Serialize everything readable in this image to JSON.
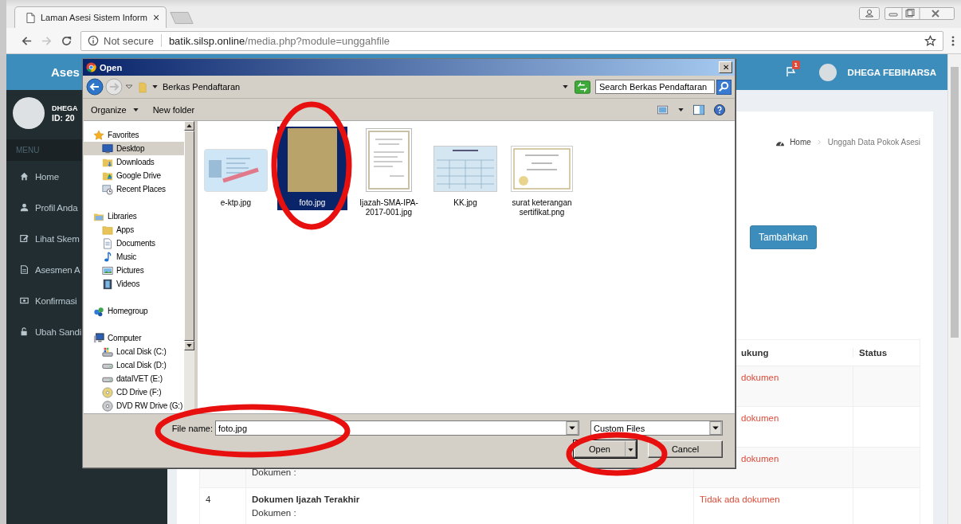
{
  "browser": {
    "tab_title": "Laman Asesi Sistem Inform",
    "close_glyph": "×",
    "security": "Not secure",
    "url_host": "batik.silsp.online",
    "url_path": "/media.php?module=unggahfile"
  },
  "app": {
    "header_title": "Ases",
    "notification_count": "1",
    "user_name": "DHEGA FEBIHARSA"
  },
  "sidebar": {
    "user_name": "DHEGA",
    "user_id": "ID: 20",
    "menu_heading": "MENU",
    "items": [
      {
        "label": "Home",
        "kind": "home"
      },
      {
        "label": "Profil Anda",
        "kind": "user"
      },
      {
        "label": "Lihat Skem",
        "kind": "edit"
      },
      {
        "label": "Asesmen A",
        "kind": "file"
      },
      {
        "label": "Konfirmasi",
        "kind": "money"
      },
      {
        "label": "Ubah Sandi",
        "kind": "unlock"
      }
    ]
  },
  "content": {
    "breadcrumb_home": "Home",
    "breadcrumb_current": "Unggah Data Pokok Asesi",
    "add_button": "Tambahkan",
    "table": {
      "columns": [
        {
          "label": "ukung",
          "covered": true
        },
        {
          "label": "Status",
          "covered": false
        }
      ],
      "rows": [
        {
          "support": "dokumen",
          "covered": true
        },
        {
          "support": "dokumen",
          "covered": true
        },
        {
          "doc_label": "Dokumen :",
          "support": "dokumen",
          "covered": true
        },
        {
          "number": "4",
          "title": "Dokumen Ijazah Terakhir",
          "doc_label": "Dokumen :",
          "support": "Tidak ada dokumen",
          "covered": false
        }
      ]
    }
  },
  "dialog": {
    "title": "Open",
    "close_glyph": "✕",
    "location": "Berkas Pendaftaran",
    "search_placeholder": "Search Berkas Pendaftaran",
    "toolbar": {
      "organize": "Organize",
      "new_folder": "New folder"
    },
    "nav": [
      {
        "label": "Favorites",
        "kind": "star",
        "selected": false,
        "children": [
          {
            "label": "Desktop",
            "kind": "desktop",
            "selected": true
          },
          {
            "label": "Downloads",
            "kind": "downloads",
            "selected": false
          },
          {
            "label": "Google Drive",
            "kind": "drive",
            "selected": false
          },
          {
            "label": "Recent Places",
            "kind": "recent",
            "selected": false
          }
        ]
      },
      {
        "label": "Libraries",
        "kind": "library",
        "selected": false,
        "children": [
          {
            "label": "Apps",
            "kind": "folder",
            "selected": false
          },
          {
            "label": "Documents",
            "kind": "documents",
            "selected": false
          },
          {
            "label": "Music",
            "kind": "music",
            "selected": false
          },
          {
            "label": "Pictures",
            "kind": "pictures",
            "selected": false
          },
          {
            "label": "Videos",
            "kind": "videos",
            "selected": false
          }
        ]
      },
      {
        "label": "Homegroup",
        "kind": "homegroup",
        "selected": false
      },
      {
        "label": "Computer",
        "kind": "computer",
        "selected": false,
        "children": [
          {
            "label": "Local Disk (C:)",
            "kind": "system-disk",
            "selected": false
          },
          {
            "label": "Local Disk (D:)",
            "kind": "disk",
            "selected": false
          },
          {
            "label": "dataIVET (E:)",
            "kind": "disk",
            "selected": false
          },
          {
            "label": "CD Drive (F:)",
            "kind": "cd",
            "selected": false
          },
          {
            "label": "DVD RW Drive (G:)",
            "kind": "dvd",
            "selected": false
          }
        ]
      }
    ],
    "files": [
      {
        "name": "e-ktp.jpg",
        "kind": "id-card",
        "selected": false
      },
      {
        "name": "foto.jpg",
        "kind": "photo",
        "selected": true
      },
      {
        "name": "Ijazah-SMA-IPA-2017-001.jpg",
        "kind": "certificate",
        "selected": false
      },
      {
        "name": "KK.jpg",
        "kind": "family-card",
        "selected": false
      },
      {
        "name": "surat keterangan sertifikat.png",
        "kind": "award",
        "selected": false
      }
    ],
    "filename_label": "File name:",
    "filename": "foto.jpg",
    "filter": "Custom Files",
    "open_button": "Open",
    "cancel_button": "Cancel"
  }
}
